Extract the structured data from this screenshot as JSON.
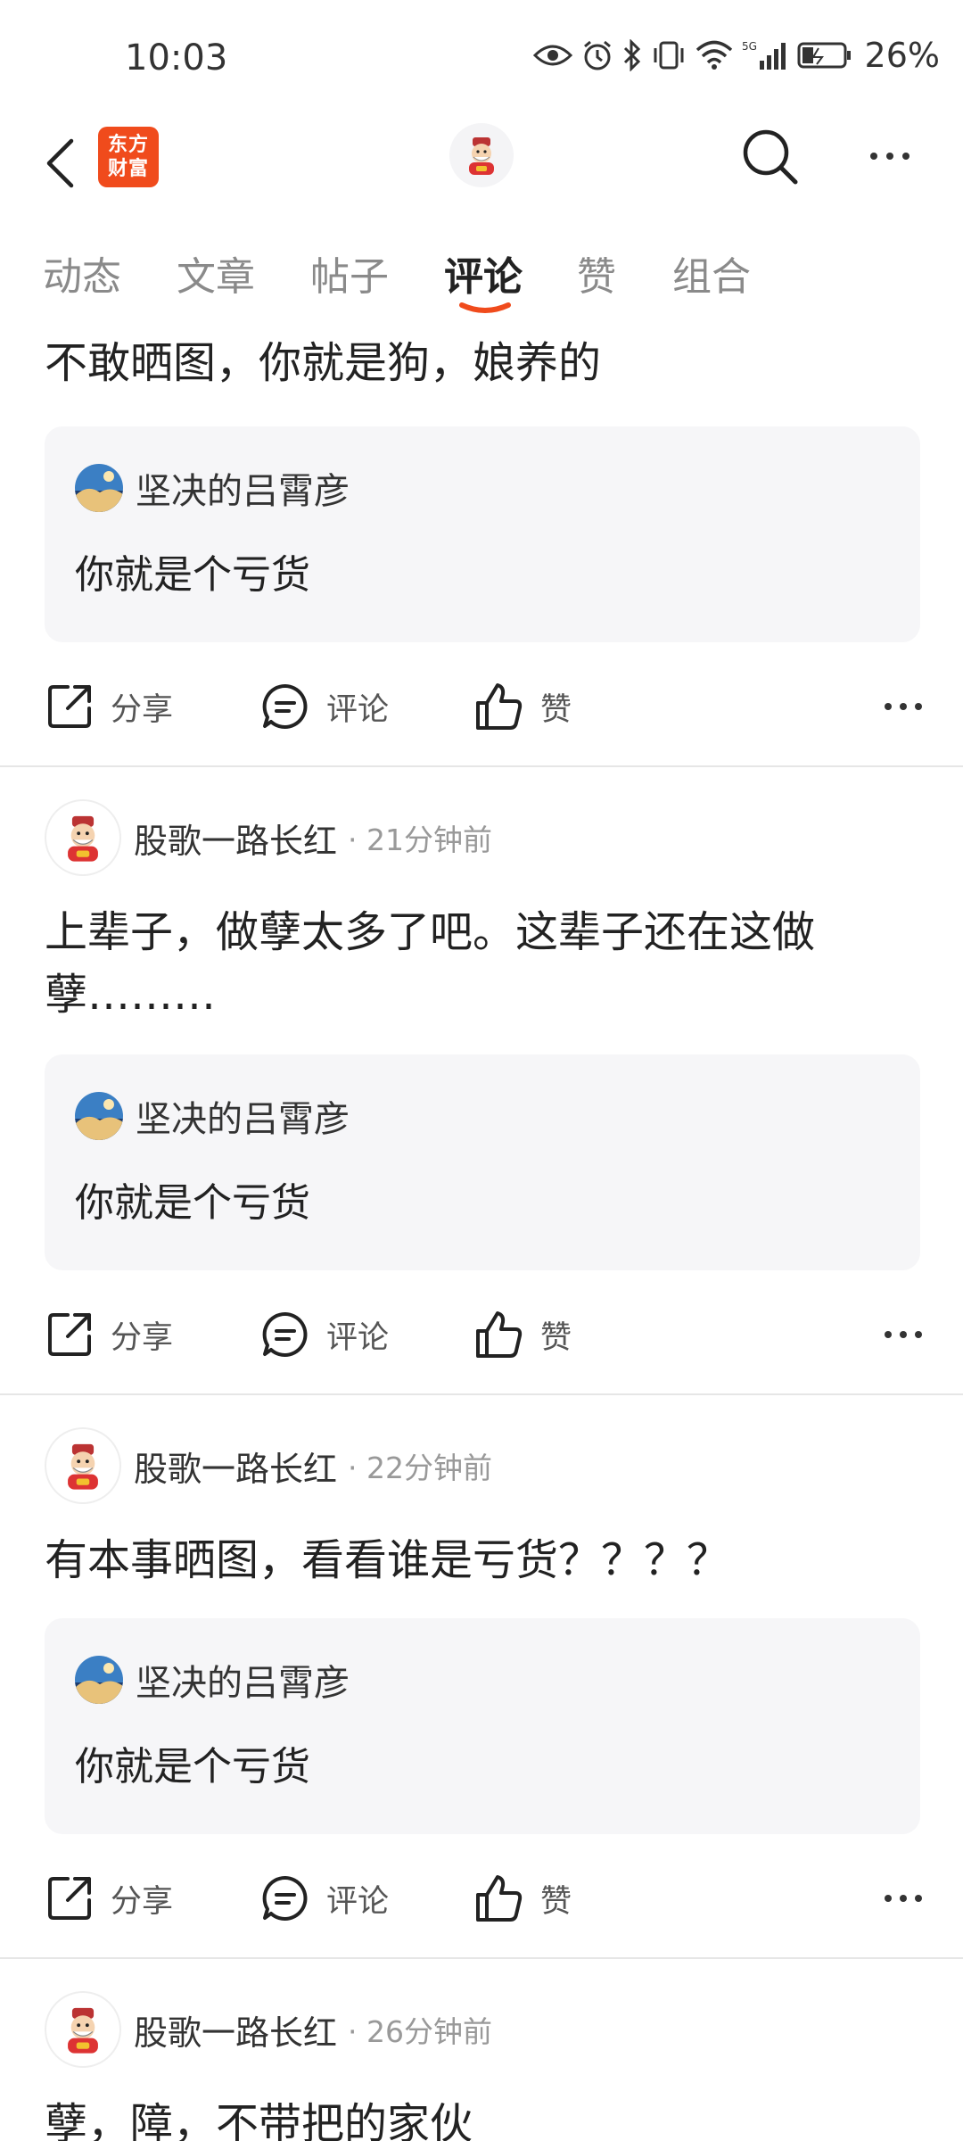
{
  "status_bar": {
    "time": "10:03",
    "battery": "26%"
  },
  "nav": {
    "logo_line1": "东方",
    "logo_line2": "财富"
  },
  "tabs": [
    {
      "label": "动态"
    },
    {
      "label": "文章"
    },
    {
      "label": "帖子"
    },
    {
      "label": "评论",
      "active": true
    },
    {
      "label": "赞"
    },
    {
      "label": "组合"
    }
  ],
  "actions": {
    "share": "分享",
    "comment": "评论",
    "like": "赞"
  },
  "posts": [
    {
      "text": "不敢晒图，你就是狗，娘养的",
      "quote": {
        "name": "坚决的吕霄彦",
        "text": "你就是个亏货"
      }
    },
    {
      "author": "股歌一路长红",
      "time": "· 21分钟前",
      "text": "上辈子，做孽太多了吧。这辈子还在这做孽………",
      "quote": {
        "name": "坚决的吕霄彦",
        "text": "你就是个亏货"
      }
    },
    {
      "author": "股歌一路长红",
      "time": "· 22分钟前",
      "text": "有本事晒图，看看谁是亏货？？？？",
      "quote": {
        "name": "坚决的吕霄彦",
        "text": "你就是个亏货"
      }
    },
    {
      "author": "股歌一路长红",
      "time": "· 26分钟前",
      "text": "孽，障，不带把的家伙"
    }
  ],
  "colors": {
    "accent": "#f04b1c",
    "quote_bg": "#f6f6f8",
    "divider": "#e6e6e6"
  }
}
